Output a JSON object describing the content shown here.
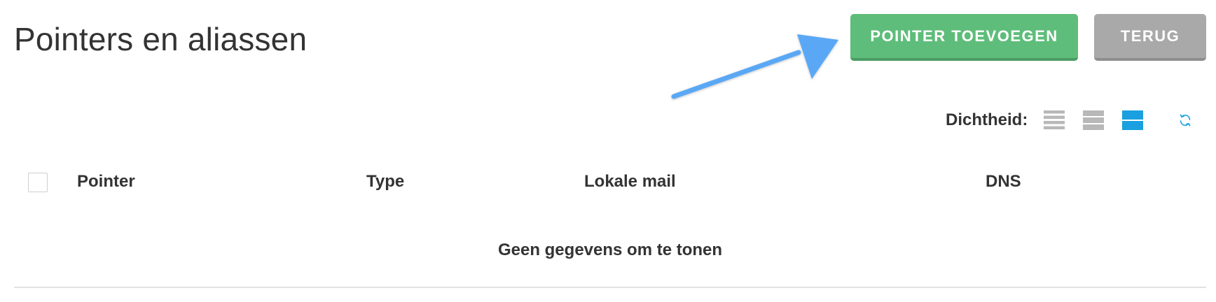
{
  "page": {
    "title": "Pointers en aliassen"
  },
  "actions": {
    "add_pointer_label": "POINTER TOEVOEGEN",
    "back_label": "TERUG"
  },
  "colors": {
    "primary_button": "#5ebd7a",
    "secondary_button": "#a9a9a9",
    "accent": "#1aa0e0",
    "annotation_arrow": "#5aa8f5"
  },
  "density": {
    "label": "Dichtheid:",
    "options": [
      "compact",
      "normal",
      "comfortable"
    ],
    "selected": "comfortable"
  },
  "table": {
    "columns": [
      "Pointer",
      "Type",
      "Lokale mail",
      "DNS"
    ],
    "rows": [],
    "empty_message": "Geen gegevens om te tonen"
  }
}
